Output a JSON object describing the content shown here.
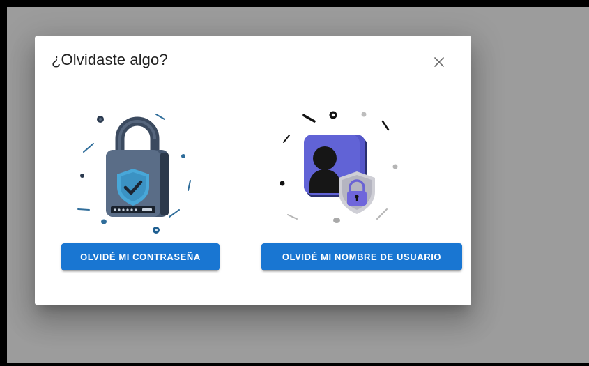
{
  "dialog": {
    "title": "¿Olvidaste algo?",
    "close_icon": "close-icon",
    "options": [
      {
        "illustration": "padlock-shield-icon",
        "button_label": "OLVIDÉ MI CONTRASEÑA"
      },
      {
        "illustration": "user-shield-icon",
        "button_label": "OLVIDÉ MI NOMBRE DE USUARIO"
      }
    ]
  },
  "colors": {
    "primary": "#1976d2",
    "backdrop": "#9c9c9c",
    "frame": "#000000",
    "surface": "#ffffff"
  }
}
